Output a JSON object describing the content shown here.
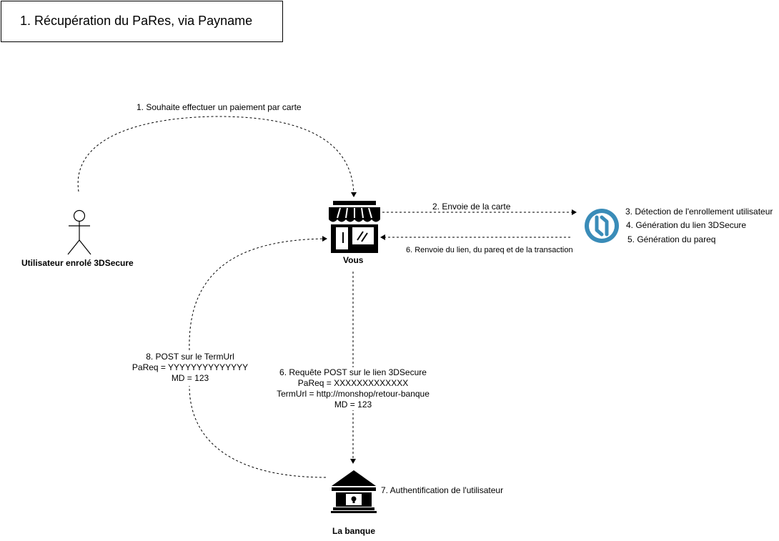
{
  "title": "1. Récupération du PaRes, via Payname",
  "actors": {
    "user": "Utilisateur enrolé 3DSecure",
    "shop": "Vous",
    "bank": "La banque"
  },
  "steps": {
    "s1": "1. Souhaite effectuer un paiement par carte",
    "s2": "2. Envoie de la carte",
    "s3": "3. Détection de l'enrollement utilisateur",
    "s4": "4. Génération du lien 3DSecure",
    "s5": "5. Génération du pareq",
    "s6_return": "6. Renvoie du lien, du pareq et de la transaction",
    "s6_post": [
      "6. Requête POST sur le lien 3DSecure",
      "PaReq = XXXXXXXXXXXXX",
      "TermUrl = http://monshop/retour-banque",
      "MD = 123"
    ],
    "s7": "7. Authentification de l'utilisateur",
    "s8": [
      "8. POST sur le TermUrl",
      "PaReq = YYYYYYYYYYYYYY",
      "MD = 123"
    ]
  },
  "icons": {
    "user": "stick-figure-icon",
    "shop": "storefront-icon",
    "payname": "payname-logo-icon",
    "bank": "bank-building-icon"
  },
  "colors": {
    "payname_logo": "#3a8cb8",
    "line": "#000000"
  }
}
